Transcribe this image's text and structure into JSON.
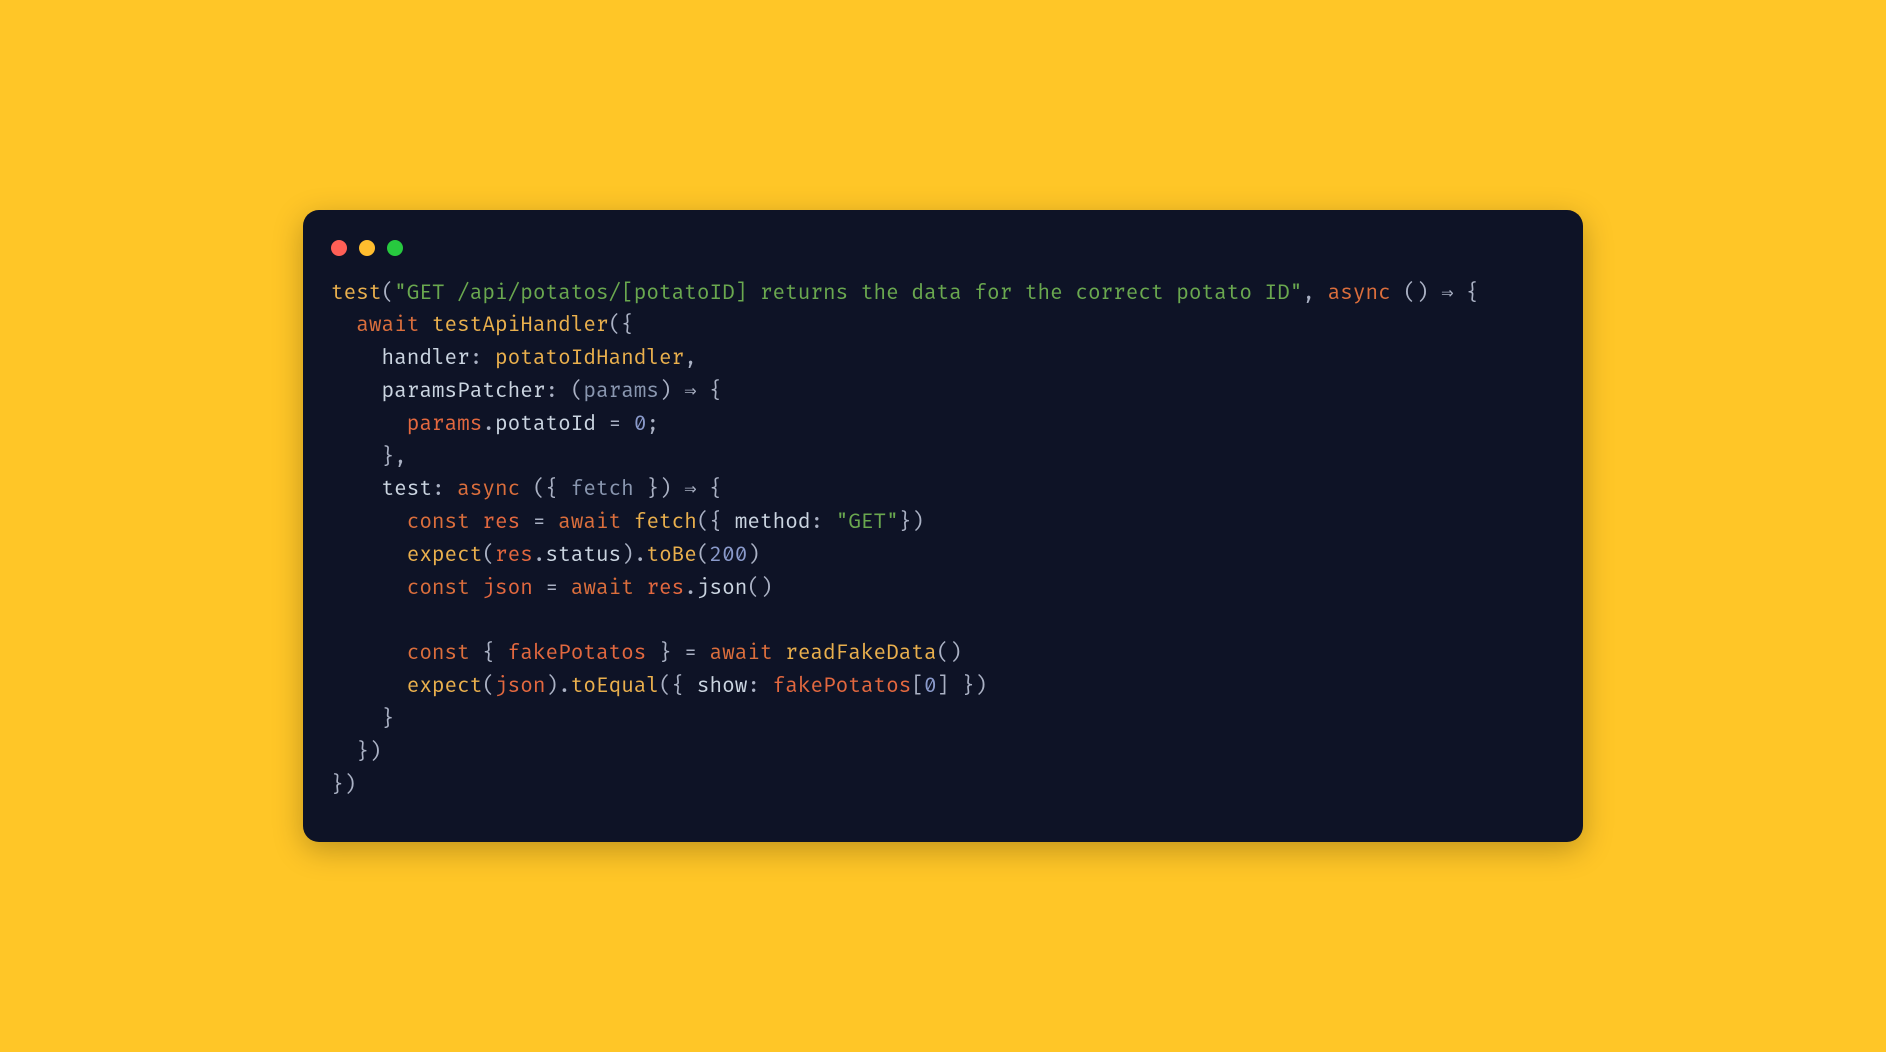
{
  "colors": {
    "page_bg": "#ffc627",
    "window_bg": "#0e1326",
    "traffic_red": "#ff5f56",
    "traffic_yellow": "#ffbd2e",
    "traffic_green": "#27c93f"
  },
  "code": {
    "fn_test": "test",
    "test_desc": "\"GET /api/potatos/[potatoID] returns the data for the correct potato ID\"",
    "kw_async": "async",
    "arrow": "⇒",
    "kw_await": "await",
    "fn_testApiHandler": "testApiHandler",
    "prop_handler": "handler",
    "fn_potatoIdHandler": "potatoIdHandler",
    "prop_paramsPatcher": "paramsPatcher",
    "param_params": "params",
    "var_params": "params",
    "prop_potatoId": "potatoId",
    "num_zero": "0",
    "prop_test": "test",
    "param_fetch": "fetch",
    "kw_const": "const",
    "var_res": "res",
    "fn_fetch": "fetch",
    "prop_method": "method",
    "str_get": "\"GET\"",
    "fn_expect": "expect",
    "prop_status": "status",
    "fn_toBe": "toBe",
    "num_200": "200",
    "var_json": "json",
    "prop_json_call": "json",
    "var_fakePotatos": "fakePotatos",
    "fn_readFakeData": "readFakeData",
    "fn_toEqual": "toEqual",
    "prop_show": "show",
    "idx_zero": "0"
  }
}
